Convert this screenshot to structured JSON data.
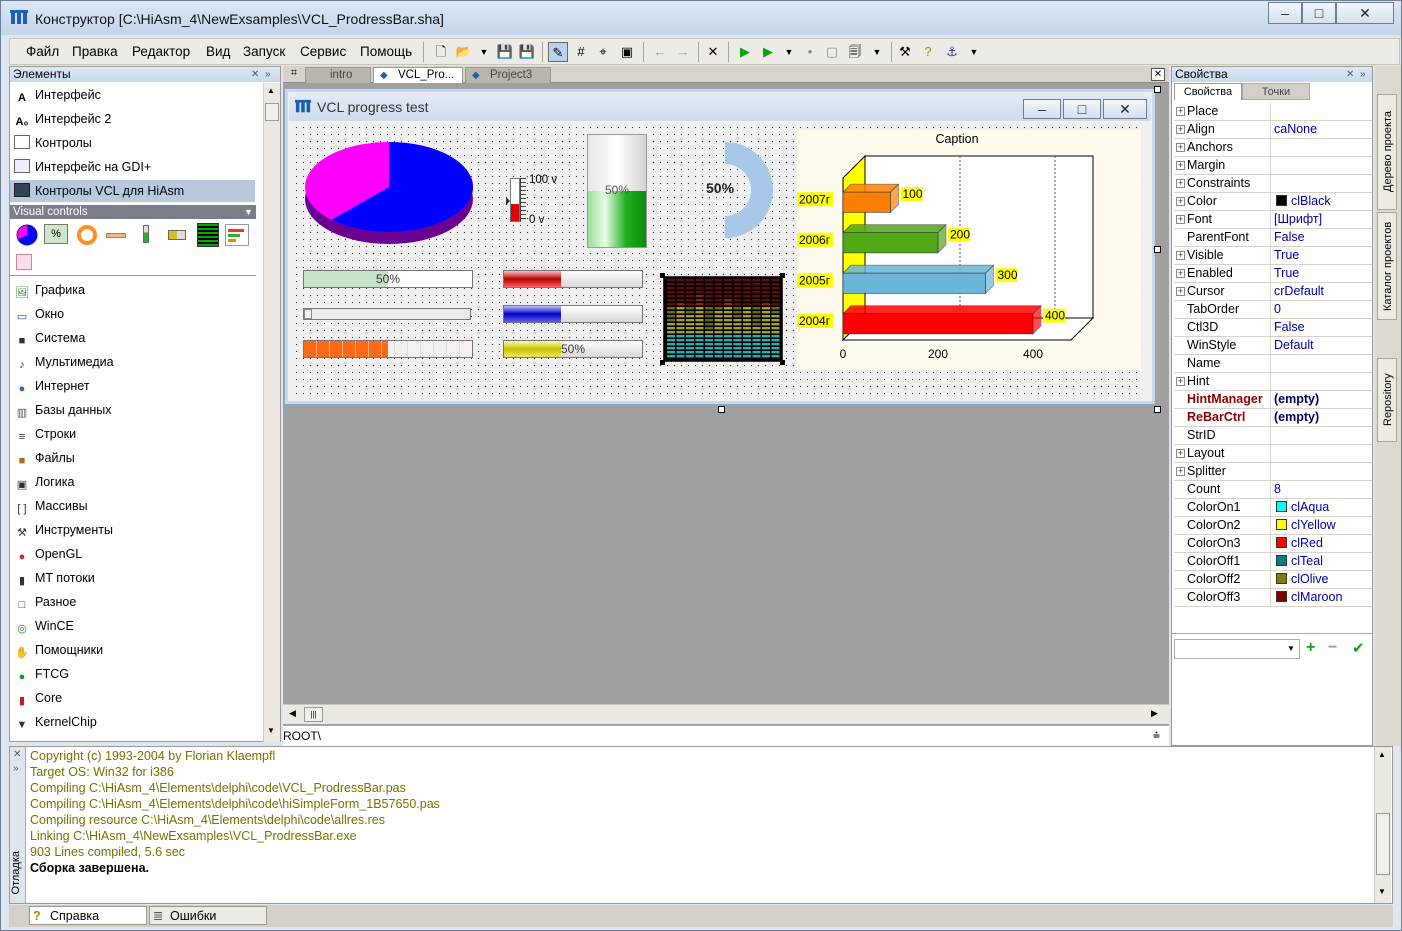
{
  "window": {
    "title": "Конструктор [C:\\HiAsm_4\\NewExsamples\\VCL_ProdressBar.sha]"
  },
  "menu": [
    "Файл",
    "Правка",
    "Редактор",
    "Вид",
    "Запуск",
    "Сервис",
    "Помощь"
  ],
  "elements_panel": {
    "title": "Элементы",
    "top_items": [
      "Интерфейс",
      "Интерфейс 2",
      "Контролы",
      "Интерфейс на GDI+",
      "Контролы VCL для HiAsm"
    ],
    "selected": "Контролы VCL для HiAsm",
    "group_header": "Visual controls",
    "categories": [
      "Графика",
      "Окно",
      "Система",
      "Мультимедиа",
      "Интернет",
      "Базы данных",
      "Строки",
      "Файлы",
      "Логика",
      "Массивы",
      "Инструменты",
      "OpenGL",
      "MT потоки",
      "Разное",
      "WinCE",
      "Помощники",
      "FTCG",
      "Core",
      "KernelChip"
    ],
    "icon_percent": "%"
  },
  "editor": {
    "tabs": [
      {
        "label": "intro"
      },
      {
        "label": "VCL_Pro..."
      },
      {
        "label": "Project3"
      }
    ],
    "active_tab": "VCL_Pro...",
    "path": "ROOT\\"
  },
  "form": {
    "title": "VCL progress test",
    "pie": {
      "slices": [
        {
          "value": 62,
          "color": "#0000ff"
        },
        {
          "value": 38,
          "color": "#ff00ff"
        }
      ]
    },
    "thermo": {
      "max_label": "100 v",
      "min_label": "0 v",
      "value": 0.4
    },
    "vertical_bar": {
      "label": "50%",
      "value": 0.5
    },
    "gauge": {
      "label": "50%",
      "value": 0.5
    },
    "progress_bars": [
      {
        "label": "50%",
        "value": 0.5,
        "style": "green"
      },
      {
        "label": "",
        "value": 0.03,
        "style": "track"
      },
      {
        "label": "",
        "value": 0.5,
        "style": "orange"
      },
      {
        "label": "",
        "value": 0.41,
        "style": "red"
      },
      {
        "label": "",
        "value": 0.41,
        "style": "blue"
      },
      {
        "label": "50%",
        "value": 0.41,
        "style": "yellow"
      }
    ]
  },
  "chart_data": {
    "type": "bar",
    "orientation": "horizontal",
    "title": "Caption",
    "categories": [
      "2007г",
      "2006г",
      "2005г",
      "2004г"
    ],
    "values": [
      100,
      200,
      300,
      400
    ],
    "colors": [
      "#ff8000",
      "#4fa814",
      "#6bb6d8",
      "#ff0000"
    ],
    "data_labels": [
      "100",
      "200",
      "300",
      "400"
    ],
    "x_ticks": [
      "0",
      "200",
      "400"
    ],
    "xlim": [
      0,
      480
    ],
    "grid": true,
    "style": "3d"
  },
  "properties_panel": {
    "title": "Свойства",
    "tabs": [
      "Свойства",
      "Точки"
    ],
    "rows": [
      {
        "name": "Place",
        "value": "",
        "expand": true
      },
      {
        "name": "Align",
        "value": "caNone",
        "expand": true
      },
      {
        "name": "Anchors",
        "value": "",
        "expand": true
      },
      {
        "name": "Margin",
        "value": "",
        "expand": true
      },
      {
        "name": "Constraints",
        "value": "",
        "expand": true
      },
      {
        "name": "Color",
        "value": "clBlack",
        "expand": true,
        "swatch": "#000000"
      },
      {
        "name": "Font",
        "value": "[Шрифт]",
        "expand": true
      },
      {
        "name": "ParentFont",
        "value": "False"
      },
      {
        "name": "Visible",
        "value": "True",
        "expand": true
      },
      {
        "name": "Enabled",
        "value": "True",
        "expand": true
      },
      {
        "name": "Cursor",
        "value": "crDefault",
        "expand": true
      },
      {
        "name": "TabOrder",
        "value": "0"
      },
      {
        "name": "Ctl3D",
        "value": "False"
      },
      {
        "name": "WinStyle",
        "value": "Default"
      },
      {
        "name": "Name",
        "value": ""
      },
      {
        "name": "Hint",
        "value": "",
        "expand": true
      },
      {
        "name": "HintManager",
        "value": "(empty)",
        "special": true
      },
      {
        "name": "ReBarCtrl",
        "value": "(empty)",
        "special": true
      },
      {
        "name": "StrID",
        "value": ""
      },
      {
        "name": "Layout",
        "value": "",
        "expand": true
      },
      {
        "name": "Splitter",
        "value": "",
        "expand": true
      },
      {
        "name": "Count",
        "value": "8"
      },
      {
        "name": "ColorOn1",
        "value": "clAqua",
        "swatch": "#00ffff"
      },
      {
        "name": "ColorOn2",
        "value": "clYellow",
        "swatch": "#ffff00"
      },
      {
        "name": "ColorOn3",
        "value": "clRed",
        "swatch": "#ff0000"
      },
      {
        "name": "ColorOff1",
        "value": "clTeal",
        "swatch": "#008080"
      },
      {
        "name": "ColorOff2",
        "value": "clOlive",
        "swatch": "#808000"
      },
      {
        "name": "ColorOff3",
        "value": "clMaroon",
        "swatch": "#800000"
      }
    ]
  },
  "side_tabs": [
    "Дерево проекта",
    "Каталог проектов",
    "Repository"
  ],
  "debug": {
    "side_label": "Отладка",
    "lines": [
      "Copyright (c) 1993-2004 by Florian Klaempfl",
      "Target OS: Win32 for i386",
      "Compiling C:\\HiAsm_4\\Elements\\delphi\\code\\VCL_ProdressBar.pas",
      "Compiling C:\\HiAsm_4\\Elements\\delphi\\code\\hiSimpleForm_1B57650.pas",
      "Compiling resource C:\\HiAsm_4\\Elements\\delphi\\code\\allres.res",
      "Linking C:\\HiAsm_4\\NewExsamples\\VCL_ProdressBar.exe",
      "903 Lines compiled, 5.6 sec"
    ],
    "final_line": "Сборка завершена."
  },
  "bottom_tabs": [
    "Справка",
    "Ошибки"
  ],
  "colors": {
    "accent": "#0000a0",
    "log_text": "#7c7000",
    "selected_bg": "#b8c9de"
  }
}
